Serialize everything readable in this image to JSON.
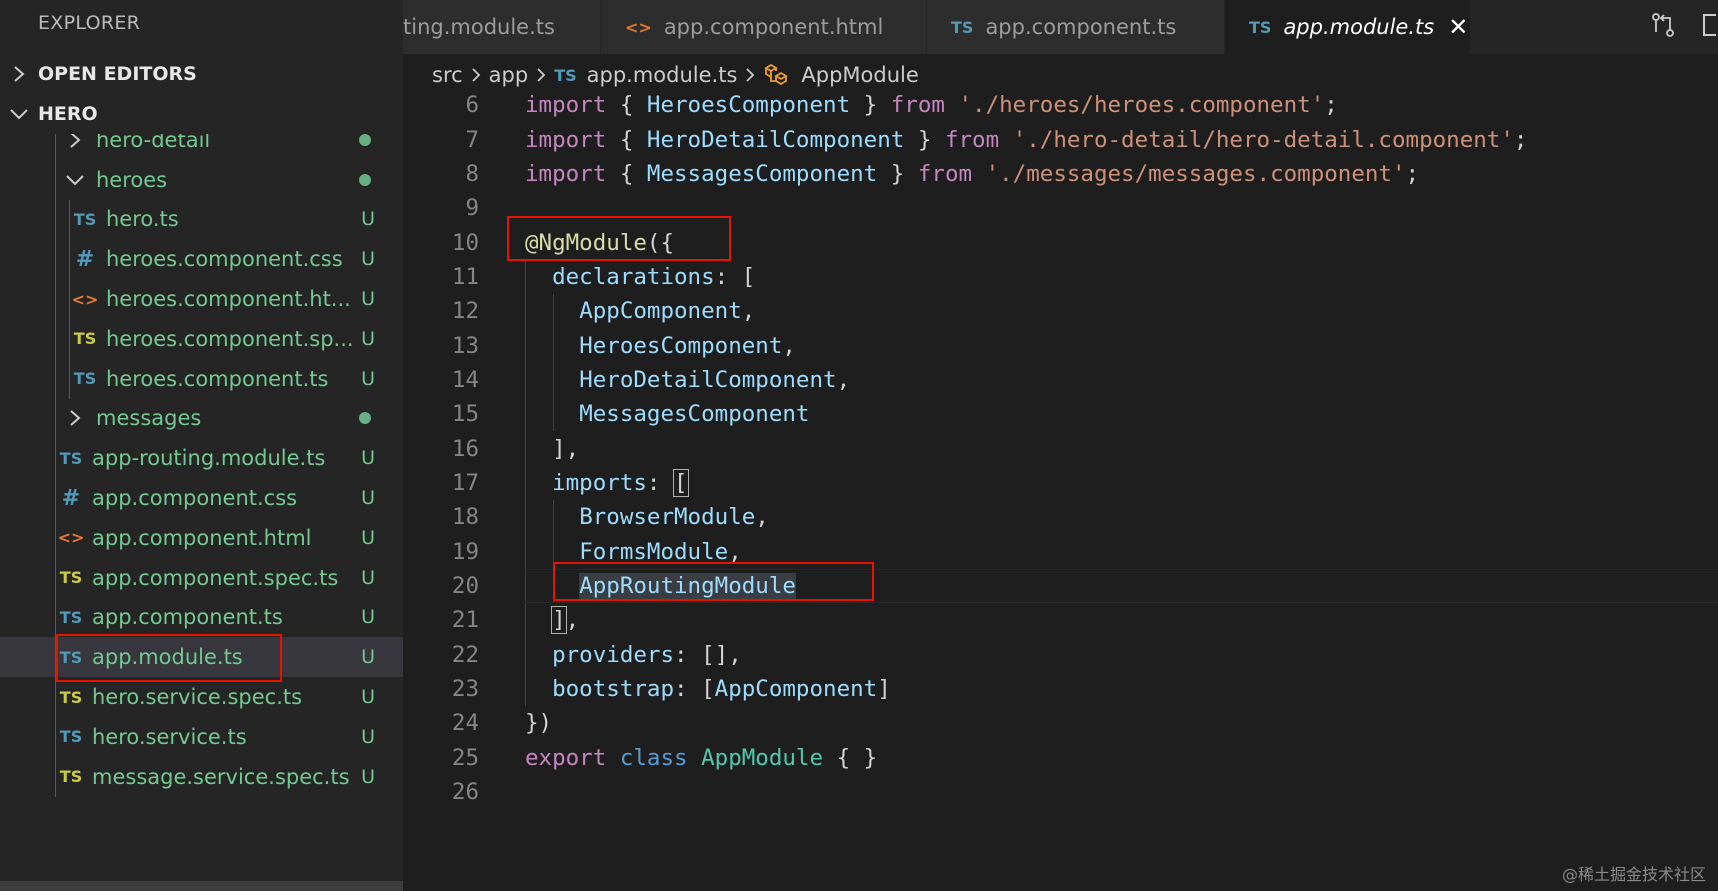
{
  "explorer": {
    "title": "EXPLORER",
    "sections": {
      "open_editors": "OPEN EDITORS",
      "project": "HERO"
    },
    "tree": [
      {
        "label": "hero-detail",
        "kind": "folder-collapsed",
        "icon": "chevron-right-icon",
        "status": "dot"
      },
      {
        "label": "heroes",
        "kind": "folder-open",
        "icon": "chevron-down-icon",
        "status": "dot"
      },
      {
        "label": "hero.ts",
        "kind": "ts",
        "status": "U"
      },
      {
        "label": "heroes.component.css",
        "kind": "css",
        "status": "U"
      },
      {
        "label": "heroes.component.ht...",
        "kind": "html",
        "status": "U"
      },
      {
        "label": "heroes.component.sp...",
        "kind": "ts-spec",
        "status": "U"
      },
      {
        "label": "heroes.component.ts",
        "kind": "ts",
        "status": "U"
      },
      {
        "label": "messages",
        "kind": "folder-collapsed",
        "icon": "chevron-right-icon",
        "status": "dot"
      },
      {
        "label": "app-routing.module.ts",
        "kind": "ts",
        "status": "U"
      },
      {
        "label": "app.component.css",
        "kind": "css",
        "status": "U"
      },
      {
        "label": "app.component.html",
        "kind": "html",
        "status": "U"
      },
      {
        "label": "app.component.spec.ts",
        "kind": "ts-spec",
        "status": "U"
      },
      {
        "label": "app.component.ts",
        "kind": "ts",
        "status": "U"
      },
      {
        "label": "app.module.ts",
        "kind": "ts",
        "status": "U",
        "selected": true
      },
      {
        "label": "hero.service.spec.ts",
        "kind": "ts-spec",
        "status": "U"
      },
      {
        "label": "hero.service.ts",
        "kind": "ts",
        "status": "U"
      },
      {
        "label": "message.service.spec.ts",
        "kind": "ts-spec",
        "status": "U"
      }
    ],
    "icon_glyphs": {
      "ts": "TS",
      "css": "#",
      "html": "<>"
    }
  },
  "tabs": [
    {
      "label": "ting.module.ts",
      "icon": ""
    },
    {
      "label": "app.component.html",
      "icon": "<>"
    },
    {
      "label": "app.component.ts",
      "icon": "TS"
    },
    {
      "label": "app.module.ts",
      "icon": "TS",
      "active": true
    }
  ],
  "breadcrumb": {
    "parts": [
      "src",
      "app",
      "app.module.ts",
      "AppModule"
    ],
    "file_icon": "TS"
  },
  "editor": {
    "lines": [
      {
        "n": "6",
        "tokens": [
          [
            "kw",
            "import"
          ],
          [
            "pn",
            " { "
          ],
          [
            "id",
            "HeroesComponent"
          ],
          [
            "pn",
            " } "
          ],
          [
            "kw",
            "from"
          ],
          [
            "pn",
            " "
          ],
          [
            "st",
            "'./heroes/heroes.component'"
          ],
          [
            "pn",
            ";"
          ]
        ]
      },
      {
        "n": "7",
        "tokens": [
          [
            "kw",
            "import"
          ],
          [
            "pn",
            " { "
          ],
          [
            "id",
            "HeroDetailComponent"
          ],
          [
            "pn",
            " } "
          ],
          [
            "kw",
            "from"
          ],
          [
            "pn",
            " "
          ],
          [
            "st",
            "'./hero-detail/hero-detail.component'"
          ],
          [
            "pn",
            ";"
          ]
        ]
      },
      {
        "n": "8",
        "tokens": [
          [
            "kw",
            "import"
          ],
          [
            "pn",
            " { "
          ],
          [
            "id",
            "MessagesComponent"
          ],
          [
            "pn",
            " } "
          ],
          [
            "kw",
            "from"
          ],
          [
            "pn",
            " "
          ],
          [
            "st",
            "'./messages/messages.component'"
          ],
          [
            "pn",
            ";"
          ]
        ]
      },
      {
        "n": "9",
        "tokens": []
      },
      {
        "n": "10",
        "tokens": [
          [
            "fn",
            "@NgModule"
          ],
          [
            "pn",
            "({"
          ]
        ]
      },
      {
        "n": "11",
        "indent": 1,
        "tokens": [
          [
            "pn",
            "  "
          ],
          [
            "id",
            "declarations"
          ],
          [
            "pn",
            ": ["
          ]
        ]
      },
      {
        "n": "12",
        "indent": 2,
        "tokens": [
          [
            "pn",
            "    "
          ],
          [
            "id",
            "AppComponent"
          ],
          [
            "pn",
            ","
          ]
        ]
      },
      {
        "n": "13",
        "indent": 2,
        "tokens": [
          [
            "pn",
            "    "
          ],
          [
            "id",
            "HeroesComponent"
          ],
          [
            "pn",
            ","
          ]
        ]
      },
      {
        "n": "14",
        "indent": 2,
        "tokens": [
          [
            "pn",
            "    "
          ],
          [
            "id",
            "HeroDetailComponent"
          ],
          [
            "pn",
            ","
          ]
        ]
      },
      {
        "n": "15",
        "indent": 2,
        "tokens": [
          [
            "pn",
            "    "
          ],
          [
            "id",
            "MessagesComponent"
          ]
        ]
      },
      {
        "n": "16",
        "indent": 1,
        "tokens": [
          [
            "pn",
            "  ],"
          ]
        ]
      },
      {
        "n": "17",
        "indent": 1,
        "tokens": [
          [
            "pn",
            "  "
          ],
          [
            "id",
            "imports"
          ],
          [
            "pn",
            ": "
          ],
          [
            "bb",
            "["
          ]
        ]
      },
      {
        "n": "18",
        "indent": 2,
        "tokens": [
          [
            "pn",
            "    "
          ],
          [
            "id",
            "BrowserModule"
          ],
          [
            "pn",
            ","
          ]
        ]
      },
      {
        "n": "19",
        "indent": 2,
        "tokens": [
          [
            "pn",
            "    "
          ],
          [
            "id",
            "FormsModule"
          ],
          [
            "pn",
            ","
          ]
        ]
      },
      {
        "n": "20",
        "indent": 2,
        "current": true,
        "tokens": [
          [
            "pn",
            "    "
          ],
          [
            "hl",
            "AppRoutingModule"
          ]
        ]
      },
      {
        "n": "21",
        "indent": 1,
        "tokens": [
          [
            "pn",
            "  "
          ],
          [
            "bb",
            "]"
          ],
          [
            "pn",
            ","
          ]
        ]
      },
      {
        "n": "22",
        "indent": 1,
        "tokens": [
          [
            "pn",
            "  "
          ],
          [
            "id",
            "providers"
          ],
          [
            "pn",
            ": [],"
          ]
        ]
      },
      {
        "n": "23",
        "indent": 1,
        "tokens": [
          [
            "pn",
            "  "
          ],
          [
            "id",
            "bootstrap"
          ],
          [
            "pn",
            ": ["
          ],
          [
            "id",
            "AppComponent"
          ],
          [
            "pn",
            "]"
          ]
        ]
      },
      {
        "n": "24",
        "tokens": [
          [
            "pn",
            "})"
          ]
        ]
      },
      {
        "n": "25",
        "tokens": [
          [
            "kw",
            "export"
          ],
          [
            "pn",
            " "
          ],
          [
            "kw2",
            "class"
          ],
          [
            "pn",
            " "
          ],
          [
            "ty",
            "AppModule"
          ],
          [
            "pn",
            " { }"
          ]
        ]
      },
      {
        "n": "26",
        "tokens": []
      }
    ]
  },
  "colors": {
    "annotation_red": "#e51400",
    "accent_blue": "#519aba",
    "git_untracked_green": "#73c991"
  },
  "watermark": "@稀土掘金技术社区"
}
